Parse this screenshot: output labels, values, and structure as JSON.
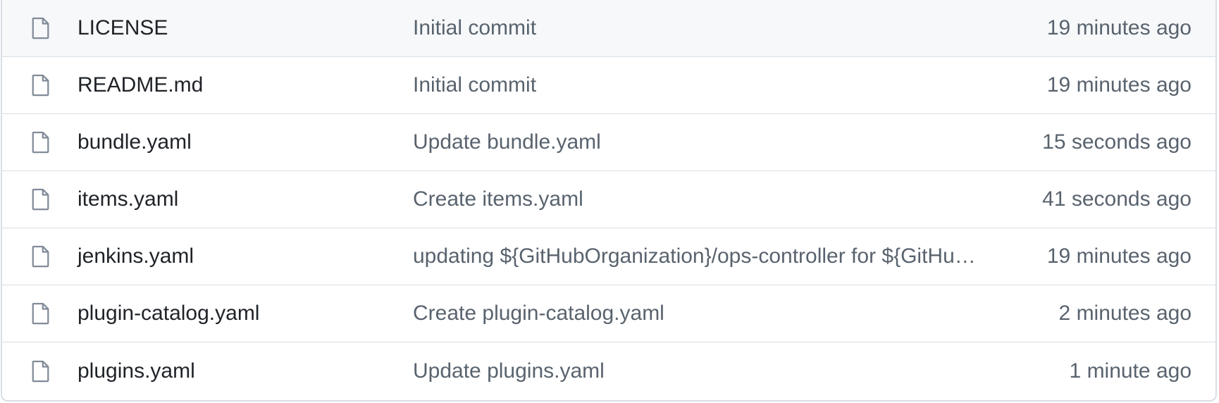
{
  "files": [
    {
      "name": "LICENSE",
      "message": "Initial commit",
      "time": "19 minutes ago",
      "icon": "file-icon"
    },
    {
      "name": "README.md",
      "message": "Initial commit",
      "time": "19 minutes ago",
      "icon": "file-icon"
    },
    {
      "name": "bundle.yaml",
      "message": "Update bundle.yaml",
      "time": "15 seconds ago",
      "icon": "file-icon"
    },
    {
      "name": "items.yaml",
      "message": "Create items.yaml",
      "time": "41 seconds ago",
      "icon": "file-icon"
    },
    {
      "name": "jenkins.yaml",
      "message": "updating ${GitHubOrganization}/ops-controller for ${GitHu…",
      "time": "19 minutes ago",
      "icon": "file-icon"
    },
    {
      "name": "plugin-catalog.yaml",
      "message": "Create plugin-catalog.yaml",
      "time": "2 minutes ago",
      "icon": "file-icon"
    },
    {
      "name": "plugins.yaml",
      "message": "Update plugins.yaml",
      "time": "1 minute ago",
      "icon": "file-icon"
    }
  ],
  "colors": {
    "border": "#d8dee4",
    "header_row_bg": "#f6f8fa",
    "text_primary": "#1f2328",
    "text_muted": "#59636e",
    "icon": "#818b98"
  }
}
